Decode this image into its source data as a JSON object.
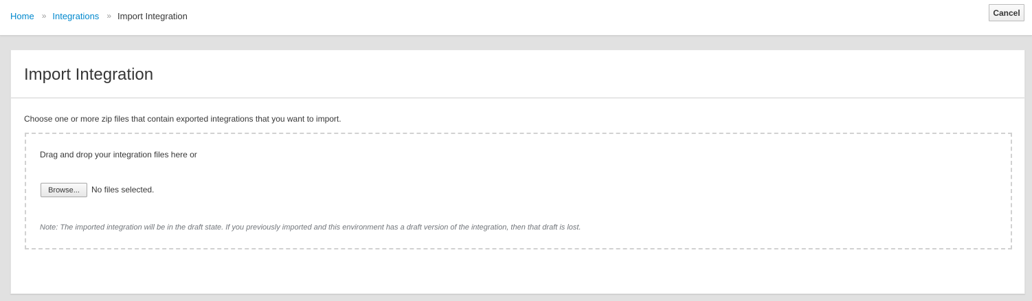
{
  "breadcrumb": {
    "items": [
      {
        "label": "Home"
      },
      {
        "label": "Integrations"
      },
      {
        "label": "Import Integration"
      }
    ],
    "separator": "»"
  },
  "header": {
    "cancel_label": "Cancel"
  },
  "card": {
    "title": "Import Integration",
    "instructions": "Choose one or more zip files that contain exported integrations that you want to import.",
    "dropzone": {
      "text": "Drag and drop your integration files here or",
      "browse_label": "Browse...",
      "file_status": "No files selected.",
      "note": "Note: The imported integration will be in the draft state. If you previously imported and this environment has a draft version of the integration, then that draft is lost."
    }
  },
  "colors": {
    "link": "#0088ce",
    "background": "#e1e1e1",
    "text": "#363636",
    "note_text": "#72767b",
    "dropzone_border": "#d1d1d1"
  }
}
